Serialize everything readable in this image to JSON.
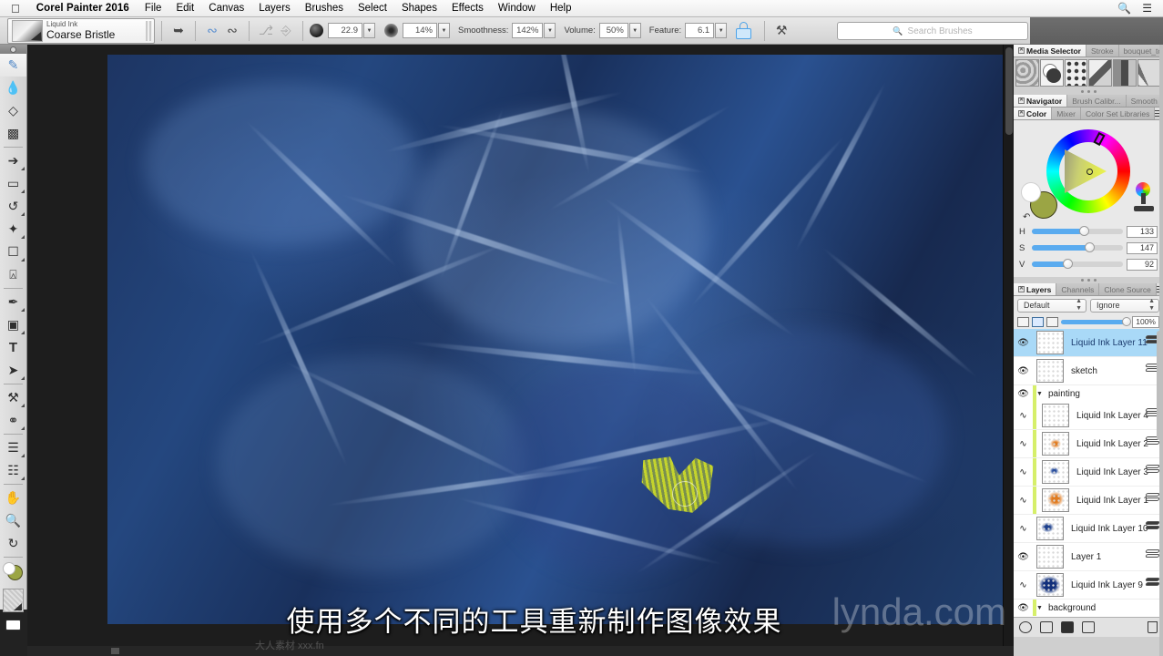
{
  "menubar": {
    "apple": "apple-logo",
    "app_name": "Corel Painter 2016",
    "items": [
      "File",
      "Edit",
      "Canvas",
      "Layers",
      "Brushes",
      "Select",
      "Shapes",
      "Effects",
      "Window",
      "Help"
    ],
    "right_icons": [
      "search-icon",
      "list-icon"
    ]
  },
  "propbar": {
    "brush_category": "Liquid Ink",
    "brush_variant": "Coarse Bristle",
    "size_value": "22.9",
    "opacity_value": "14%",
    "smoothness_label": "Smoothness:",
    "smoothness_value": "142%",
    "volume_label": "Volume:",
    "volume_value": "50%",
    "feature_label": "Feature:",
    "feature_value": "6.1",
    "lock_icon": "lock-icon",
    "search_placeholder": "Search Brushes"
  },
  "toolbox": {
    "items": [
      "brush-tool",
      "dropper-tool",
      "paint-bucket-tool",
      "eraser-tool",
      "layer-adjuster-tool",
      "rectangular-selection-tool",
      "lasso-tool",
      "magic-wand-tool",
      "selection-adjuster-tool",
      "crop-tool",
      "pen-tool",
      "shape-tool",
      "text-tool",
      "shape-selection-tool",
      "cloner-tool",
      "mirror-tool",
      "divine-proportion-tool",
      "perspective-grid-tool",
      "grabber-tool",
      "magnifier-tool",
      "rotate-page-tool"
    ],
    "color_swatch_main": "#9ba544",
    "color_swatch_secondary": "#ffffff",
    "paper_selector": "paper-texture-selector",
    "screen_mode": "screen-mode-toggle"
  },
  "canvas": {
    "zoom_area": "painting-canvas",
    "subtitle": "使用多个不同的工具重新制作图像效果",
    "watermark": "lynda.com",
    "site_mark": "大人素材 xxx.fn"
  },
  "right_panels": {
    "media": {
      "tabs": [
        "Media Selector",
        "Stroke",
        "bouquet_to"
      ],
      "active_tab": "Media Selector",
      "thumbnails": [
        "paper-texture-thumb",
        "gradient-thumb",
        "pattern-thumb",
        "nozzle-thumb",
        "weave-thumb",
        "look-thumb"
      ]
    },
    "navigator": {
      "tabs": [
        "Navigator",
        "Brush Calibr...",
        "Smooth"
      ],
      "active_tab": "Navigator"
    },
    "color": {
      "tabs": [
        "Color",
        "Mixer",
        "Color Set Libraries"
      ],
      "active_tab": "Color",
      "sliders": [
        {
          "label": "H",
          "value": "133",
          "pct": 56
        },
        {
          "label": "S",
          "value": "147",
          "pct": 62
        },
        {
          "label": "V",
          "value": "92",
          "pct": 38
        }
      ],
      "main_color": "#9ba544",
      "secondary_color": "#ffffff",
      "clone_color_icon": "clone-color-icon"
    },
    "layers": {
      "tabs": [
        "Layers",
        "Channels",
        "Clone Source"
      ],
      "active_tab": "Layers",
      "blend_mode": "Default",
      "pickup_mode": "Ignore",
      "opacity": "100%",
      "rows": [
        {
          "name": "Liquid Ink Layer 11",
          "visible": true,
          "selected": true,
          "in_group": false,
          "thumb": "empty"
        },
        {
          "name": "sketch",
          "visible": true,
          "selected": false,
          "in_group": false,
          "thumb": "empty"
        },
        {
          "name": "painting",
          "group": true,
          "visible": true,
          "expanded": true
        },
        {
          "name": "Liquid Ink Layer 4",
          "visible": false,
          "selected": false,
          "in_group": true,
          "thumb": "faint"
        },
        {
          "name": "Liquid Ink Layer 2",
          "visible": false,
          "selected": false,
          "in_group": true,
          "thumb": "orange"
        },
        {
          "name": "Liquid Ink Layer 3",
          "visible": false,
          "selected": false,
          "in_group": true,
          "thumb": "blue-dots"
        },
        {
          "name": "Liquid Ink Layer 1",
          "visible": false,
          "selected": false,
          "in_group": true,
          "thumb": "orange"
        },
        {
          "name": "Liquid Ink Layer 10",
          "visible": false,
          "selected": false,
          "in_group": false,
          "thumb": "blue-dots"
        },
        {
          "name": "Layer 1",
          "visible": true,
          "selected": false,
          "in_group": false,
          "thumb": "empty"
        },
        {
          "name": "Liquid Ink Layer 9",
          "visible": false,
          "selected": false,
          "in_group": false,
          "thumb": "blue-scribble"
        },
        {
          "name": "background",
          "group": true,
          "visible": true,
          "expanded": true
        }
      ],
      "footer_buttons": [
        "dynamic-plugins-button",
        "new-layer-button",
        "new-layer-mask-button",
        "layer-lock-button",
        "delete-layer-button"
      ]
    }
  }
}
